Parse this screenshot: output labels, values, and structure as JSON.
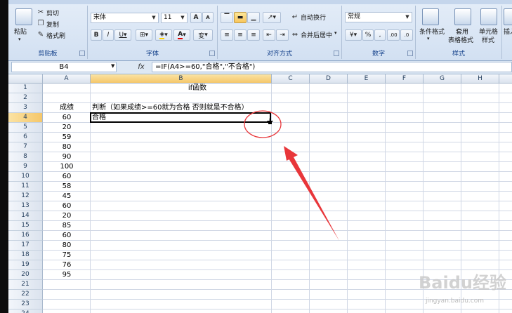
{
  "ribbon": {
    "clipboard": {
      "paste": "粘贴",
      "cut": "剪切",
      "copy": "复制",
      "format_painter": "格式刷",
      "label": "剪贴板"
    },
    "font": {
      "name": "宋体",
      "size": "11",
      "bold": "B",
      "italic": "I",
      "underline": "U",
      "grow": "A",
      "shrink": "A",
      "color_letter": "A",
      "phonetic": "变",
      "label": "字体"
    },
    "alignment": {
      "wrap": "自动换行",
      "merge": "合并后居中",
      "label": "对齐方式"
    },
    "number": {
      "format": "常规",
      "percent": "%",
      "comma": ",",
      "inc_decimal": ".00",
      "dec_decimal": ".0",
      "label": "数字"
    },
    "styles": {
      "conditional_1": "条件格式",
      "table_1": "套用",
      "table_2": "表格格式",
      "cell_1": "单元格",
      "cell_2": "样式",
      "label": "样式"
    },
    "cells": {
      "insert": "插入"
    }
  },
  "formula_bar": {
    "name_box": "B4",
    "fx": "fx",
    "formula": "=IF(A4>=60,\"合格\",\"不合格\")"
  },
  "columns": [
    "A",
    "B",
    "C",
    "D",
    "E",
    "F",
    "G",
    "H",
    "I"
  ],
  "rows": [
    "1",
    "2",
    "3",
    "4",
    "5",
    "6",
    "7",
    "8",
    "9",
    "10",
    "11",
    "12",
    "13",
    "14",
    "15",
    "16",
    "17",
    "18",
    "19",
    "20",
    "21",
    "22",
    "23",
    "24"
  ],
  "cells": {
    "b1": "if函数",
    "a3": "成绩",
    "b3": "判断（如果成绩>=60就为合格 否则就是不合格）",
    "b4": "合格",
    "a_values": [
      "60",
      "20",
      "59",
      "80",
      "90",
      "100",
      "60",
      "58",
      "45",
      "60",
      "20",
      "85",
      "60",
      "80",
      "75",
      "76",
      "95"
    ]
  },
  "watermark": {
    "main": "Baidu经验",
    "sub": "jingyan.baidu.com"
  },
  "colors": {
    "annotation": "#e8363a",
    "selection": "#000000"
  }
}
